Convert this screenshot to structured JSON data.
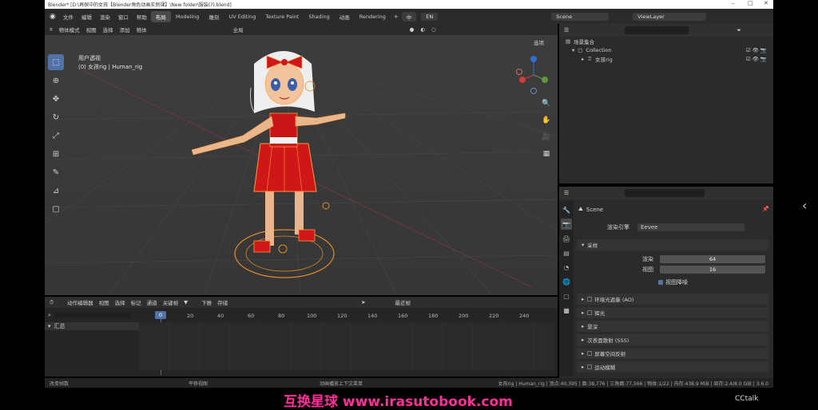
{
  "title_bar": {
    "text": "Blender* [D:\\再探中的女孩【Blender角色动画实例课】\\New folder\\服装(?).blend]"
  },
  "top_menu": {
    "items": [
      "文件",
      "编辑",
      "渲染",
      "窗口",
      "帮助"
    ],
    "workspaces": [
      "布局",
      "Modeling",
      "雕刻",
      "UV Editing",
      "Texture Paint",
      "Shading",
      "动画",
      "Rendering"
    ],
    "active_workspace": "布局",
    "lang_cn": "中",
    "lang_en": "EN",
    "scene": "Scene",
    "view_layer": "ViewLayer"
  },
  "viewport": {
    "mode": "物体模式",
    "menu": [
      "视图",
      "选择",
      "添加",
      "物体"
    ],
    "transform_orientation": "全局",
    "options": "选项",
    "view_name": "用户透视",
    "object_info": "(0) 女孩rig | Human_rig"
  },
  "outliner": {
    "scene_collection": "场景集合",
    "collection": "Collection",
    "object": "女孩rig"
  },
  "properties": {
    "scene_name": "Scene",
    "render_engine_label": "渲染引擎",
    "render_engine": "Eevee",
    "sampling_label": "采样",
    "render_label": "渲染",
    "render_samples": "64",
    "viewport_label": "视图",
    "viewport_samples": "16",
    "denoise_label": "视图降噪",
    "sections": [
      "环境光遮蔽 (AO)",
      "辉光",
      "景深",
      "次表面散射 (SSS)",
      "屏幕空间反射",
      "运动模糊"
    ]
  },
  "timeline": {
    "editor": "动作编辑器",
    "menu": [
      "视图",
      "选择",
      "标记",
      "通道",
      "关键帧"
    ],
    "push_down": "下推",
    "stash": "存储",
    "interpolation": "最近帧",
    "summary": "汇总",
    "current_frame": "0",
    "frames": [
      "20",
      "40",
      "60",
      "80",
      "100",
      "120",
      "140",
      "160",
      "180",
      "200",
      "220",
      "240"
    ]
  },
  "status_bar": {
    "left": "改变帧数",
    "middle": "平移视图",
    "right": "动画播放上下文菜单",
    "stats": "女孩rig | Human_rig | 顶点:40,395 | 面:38,776 | 三角面:77,566 | 物体:1/22 | 内存:438.9 MiB | 显存:2.4/8.0 GiB | 3.6.0"
  },
  "watermark": {
    "text": "互换星球 www.irasutobook.com",
    "brand": "CCtalk"
  },
  "colors": {
    "accent": "#5172a8",
    "selection_outline": "#ff9a3c",
    "character_red": "#d01818"
  }
}
